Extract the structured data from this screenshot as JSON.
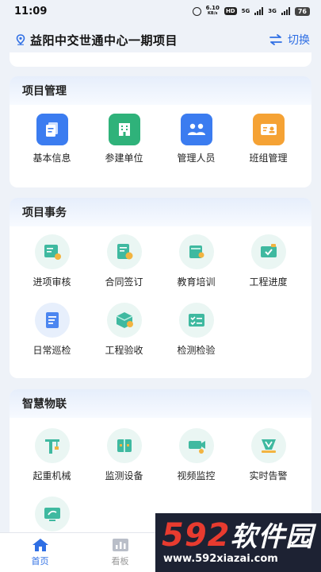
{
  "status_bar": {
    "time": "11:09",
    "speed": "6.10",
    "speed_unit": "KB/s",
    "hd": "HD",
    "net1": "5G",
    "net2": "3G",
    "battery": "76"
  },
  "header": {
    "project_name": "益阳中交世通中心一期项目",
    "switch_label": "切换"
  },
  "sections": [
    {
      "title": "项目管理",
      "items": [
        {
          "label": "基本信息",
          "icon": "document-icon",
          "color": "#3b7cf0"
        },
        {
          "label": "参建单位",
          "icon": "building-icon",
          "color": "#2fb27a"
        },
        {
          "label": "管理人员",
          "icon": "people-icon",
          "color": "#3b7cf0"
        },
        {
          "label": "班组管理",
          "icon": "team-card-icon",
          "color": "#f5a234"
        }
      ]
    },
    {
      "title": "项目事务",
      "items": [
        {
          "label": "进项审核",
          "icon": "audit-icon"
        },
        {
          "label": "合同签订",
          "icon": "contract-icon"
        },
        {
          "label": "教育培训",
          "icon": "training-icon"
        },
        {
          "label": "工程进度",
          "icon": "progress-icon"
        },
        {
          "label": "日常巡检",
          "icon": "inspection-icon"
        },
        {
          "label": "工程验收",
          "icon": "acceptance-icon"
        },
        {
          "label": "检测检验",
          "icon": "testing-icon"
        }
      ]
    },
    {
      "title": "智慧物联",
      "items": [
        {
          "label": "起重机械",
          "icon": "crane-icon"
        },
        {
          "label": "监测设备",
          "icon": "monitor-device-icon"
        },
        {
          "label": "视频监控",
          "icon": "camera-icon"
        },
        {
          "label": "实时告警",
          "icon": "alarm-icon"
        },
        {
          "label": "",
          "icon": "screen-icon"
        }
      ]
    }
  ],
  "tabbar": {
    "tabs": [
      {
        "label": "首页",
        "icon": "home-icon",
        "active": true
      },
      {
        "label": "看板",
        "icon": "chart-icon",
        "active": false
      }
    ]
  },
  "watermark": {
    "num": "592",
    "cn": "软件园",
    "url": "www.592xiazai.com"
  },
  "colors": {
    "accent": "#2f6fe4",
    "teal": "#2fb29b"
  }
}
